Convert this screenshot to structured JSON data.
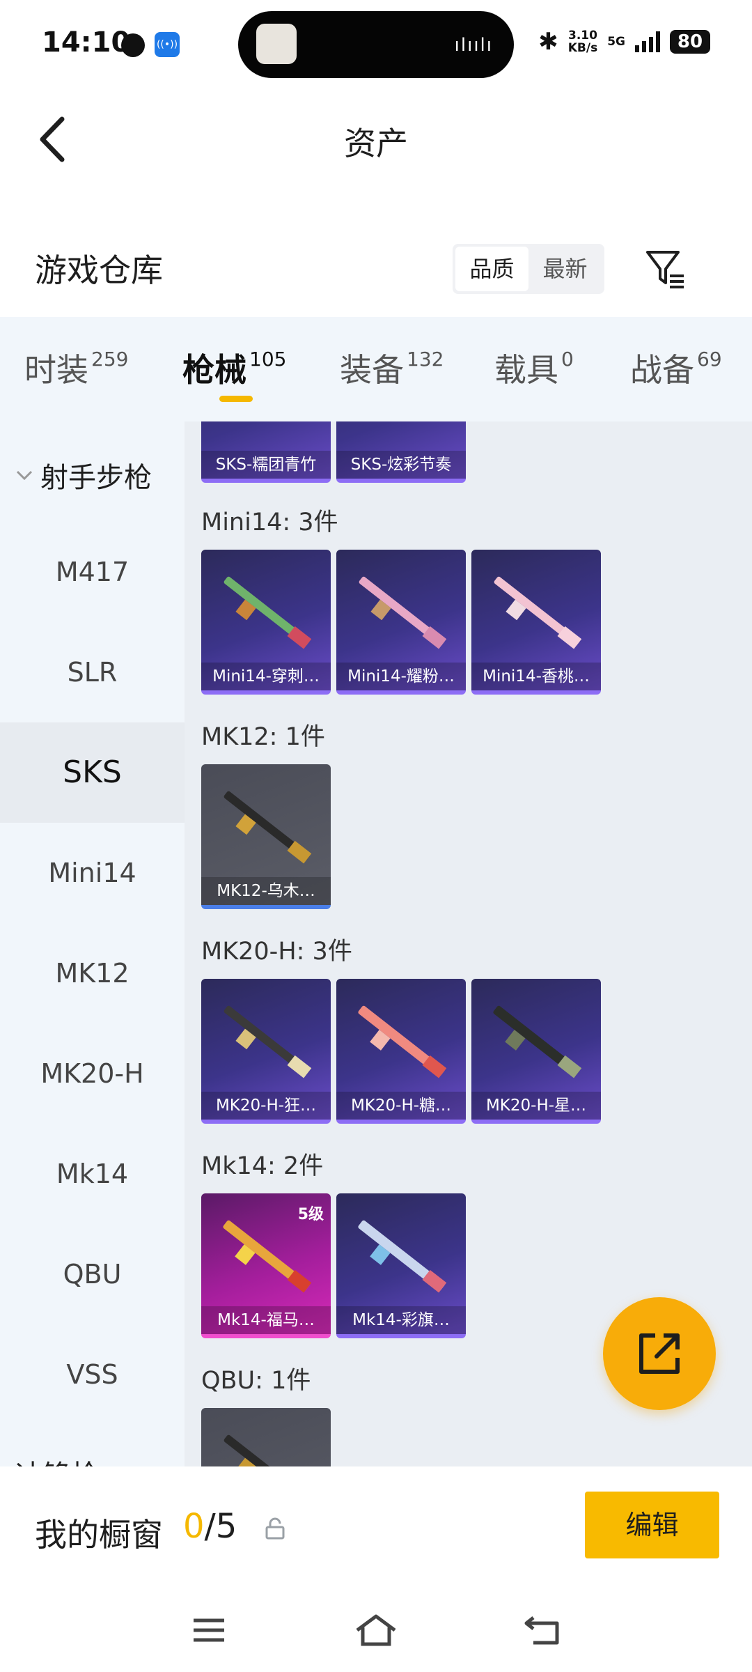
{
  "status_bar": {
    "time": "14:10",
    "network_speed_value": "3.10",
    "network_speed_unit": "KB/s",
    "network_type": "5G",
    "battery": "80",
    "icons": [
      "vpn-icon",
      "nfc-icon",
      "bluetooth-icon",
      "signal-icon",
      "battery-icon"
    ]
  },
  "header": {
    "title": "资产",
    "back_icon": "chevron-left-icon"
  },
  "warehouse": {
    "title": "游戏仓库",
    "sort_options": [
      "品质",
      "最新"
    ],
    "active_sort": "品质",
    "filter_icon": "filter-icon"
  },
  "tabs": [
    {
      "label": "时装",
      "count": "259"
    },
    {
      "label": "枪械",
      "count": "105"
    },
    {
      "label": "装备",
      "count": "132"
    },
    {
      "label": "载具",
      "count": "0"
    },
    {
      "label": "战备",
      "count": "69"
    }
  ],
  "active_tab": "枪械",
  "colors": {
    "accent": "#f5b800",
    "fab": "#f8ac09",
    "purple_rarity": "#8d6df5",
    "blue_rarity": "#4a7ee8",
    "pink_rarity": "#f04ecd"
  },
  "sidebar": {
    "group": "射手步枪",
    "items": [
      "M417",
      "SLR",
      "SKS",
      "Mini14",
      "MK12",
      "MK20-H",
      "Mk14",
      "QBU",
      "VSS"
    ],
    "active": "SKS",
    "next_group_partial": "冲锋枪"
  },
  "sections": [
    {
      "title": "",
      "items": [
        {
          "label": "SKS-糯团青竹",
          "rarity": "purple"
        },
        {
          "label": "SKS-炫彩节奏",
          "rarity": "purple"
        }
      ]
    },
    {
      "title": "Mini14: 3件",
      "items": [
        {
          "label": "Mini14-穿刺…",
          "rarity": "purple"
        },
        {
          "label": "Mini14-耀粉…",
          "rarity": "purple"
        },
        {
          "label": "Mini14-香桃…",
          "rarity": "purple"
        }
      ]
    },
    {
      "title": "MK12: 1件",
      "items": [
        {
          "label": "MK12-乌木…",
          "rarity": "gray"
        }
      ]
    },
    {
      "title": "MK20-H: 3件",
      "items": [
        {
          "label": "MK20-H-狂…",
          "rarity": "purple"
        },
        {
          "label": "MK20-H-糖…",
          "rarity": "purple"
        },
        {
          "label": "MK20-H-星…",
          "rarity": "purple"
        }
      ]
    },
    {
      "title": "Mk14: 2件",
      "items": [
        {
          "label": "Mk14-福马…",
          "rarity": "pink",
          "level": "5级"
        },
        {
          "label": "Mk14-彩旗…",
          "rarity": "purple"
        }
      ]
    },
    {
      "title": "QBU: 1件",
      "items": [
        {
          "label": "",
          "rarity": "gray"
        }
      ]
    }
  ],
  "fab": {
    "icon": "share-export-icon"
  },
  "bottom_bar": {
    "title": "我的橱窗",
    "current": "0",
    "total": "/5",
    "lock_icon": "lock-icon",
    "edit_label": "编辑"
  },
  "nav": {
    "icons": [
      "menu-icon",
      "home-icon",
      "back-icon"
    ]
  }
}
